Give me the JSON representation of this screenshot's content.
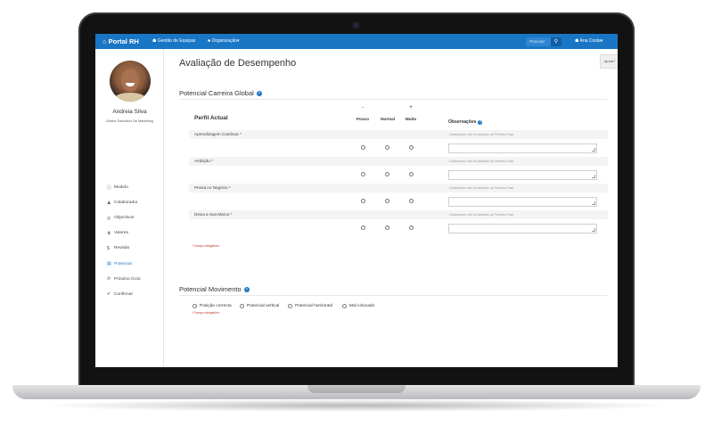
{
  "topbar": {
    "brand": "Portal RH",
    "nav": [
      {
        "icon": "users-icon",
        "label": "Gestão de Equipas"
      },
      {
        "icon": "sitemap-icon",
        "label": "Organização▾"
      }
    ],
    "search_placeholder": "Procurar",
    "user_label": "Ana Costa▾",
    "color": "#1976c5"
  },
  "profile": {
    "name": "Andreia Silva",
    "role": "Diretor Executivo De Marketing"
  },
  "sidebar": {
    "items": [
      {
        "icon": "info-icon",
        "label": "Modelo"
      },
      {
        "icon": "user-icon",
        "label": "Colaborador"
      },
      {
        "icon": "target-icon",
        "label": "Objectivos"
      },
      {
        "icon": "trophy-icon",
        "label": "Valores"
      },
      {
        "icon": "dollar-icon",
        "label": "Revisão"
      },
      {
        "icon": "chart-icon",
        "label": "Potencial",
        "active": true
      },
      {
        "icon": "cycle-icon",
        "label": "Próximo Ciclo"
      },
      {
        "icon": "check-icon",
        "label": "Confirmar"
      }
    ]
  },
  "main": {
    "title": "Avaliação de Desempenho",
    "help_label": "Ajuda?",
    "potencial_global": {
      "title": "Potencial Carreira Global",
      "perfil_header": "Perfil Actual",
      "columns": [
        {
          "symbol": "-",
          "label": "Pouco"
        },
        {
          "symbol": "",
          "label": "Normal"
        },
        {
          "symbol": "+",
          "label": "Muito"
        }
      ],
      "obs_header": "Observações",
      "rows": [
        {
          "label": "Aprendizagem Contínua *",
          "note": "Colaborador não foi avaliado na Primeira Fase"
        },
        {
          "label": "Ambição *",
          "note": "Colaborador não foi avaliado na Primeira Fase"
        },
        {
          "label": "Pensa no Negócio *",
          "note": "Colaborador não foi avaliado na Primeira Fase"
        },
        {
          "label": "Deixa a Sua Marca *",
          "note": "Colaborador não foi avaliado na Primeira Fase"
        }
      ],
      "required_note": "*Campo obrigatório"
    },
    "potencial_movimento": {
      "title": "Potencial Movimento",
      "options": [
        "Posição correcta",
        "Potencial vertical",
        "Potencial horizontal",
        "Mal colocado"
      ],
      "required_note": "*Campo obrigatório"
    }
  }
}
